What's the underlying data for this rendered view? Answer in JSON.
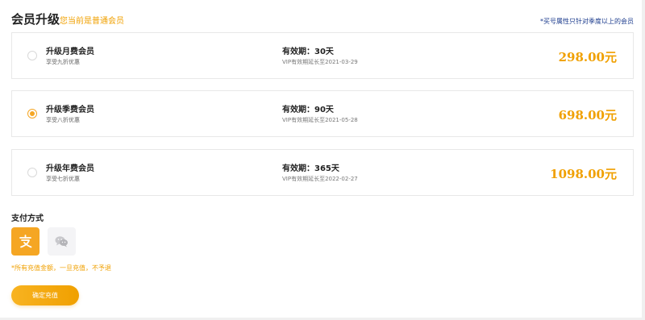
{
  "header": {
    "title": "会员升级",
    "subtitle": "您当前是普通会员",
    "note": "*买号属性只针对季度以上的会员"
  },
  "plans": [
    {
      "name": "升级月费会员",
      "desc": "享受九折优惠",
      "validity": "有效期：30天",
      "expiry": "VIP有效期延长至2021-03-29",
      "price": "298.00元",
      "selected": false
    },
    {
      "name": "升级季费会员",
      "desc": "享受八折优惠",
      "validity": "有效期：90天",
      "expiry": "VIP有效期延长至2021-05-28",
      "price": "698.00元",
      "selected": true
    },
    {
      "name": "升级年费会员",
      "desc": "享受七折优惠",
      "validity": "有效期：365天",
      "expiry": "VIP有效期延长至2022-02-27",
      "price": "1098.00元",
      "selected": false
    }
  ],
  "payment": {
    "title": "支付方式",
    "methods": [
      {
        "icon": "alipay-icon",
        "selected": true
      },
      {
        "icon": "wechat-icon",
        "selected": false
      }
    ]
  },
  "warning": "*所有充值金额，一旦充值，不予退",
  "confirm_label": "确定充值",
  "colors": {
    "accent": "#f0a000",
    "note": "#1a3a8c",
    "border": "#e8e8e8"
  }
}
